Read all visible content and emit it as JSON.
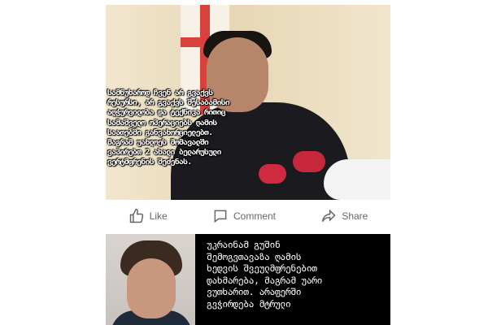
{
  "post_top": {
    "overlay_text": "სამწუხაროდ ჩვენ არ გვაქვს\nრესურსი, არ გვაქვს შესაბამისი\nაღჭურვილობა  და ტექნიკა რითიც\nსამაშველო ოპერაციებს ღამის\nსაათებში განვახორციელებთ.\nმაგრამ უახლოეს მომავალში\nვაპირებთ 2 ახალი ბელარუსული\nვერტმფრენის შეძენას."
  },
  "actions": {
    "like_label": "Like",
    "comment_label": "Comment",
    "share_label": "Share"
  },
  "post_bottom": {
    "text": "უკრაინამ გუშინ\nშემოგვთავაზა ღამის\nხედვის შვეულმფრენებით\nდახმარება, მაგრამ უარი\nვუთხარით.  არაფერში\nგვჭირდება მტრული"
  },
  "colors": {
    "action_text": "#65676b",
    "bottom_panel": "#000000"
  }
}
